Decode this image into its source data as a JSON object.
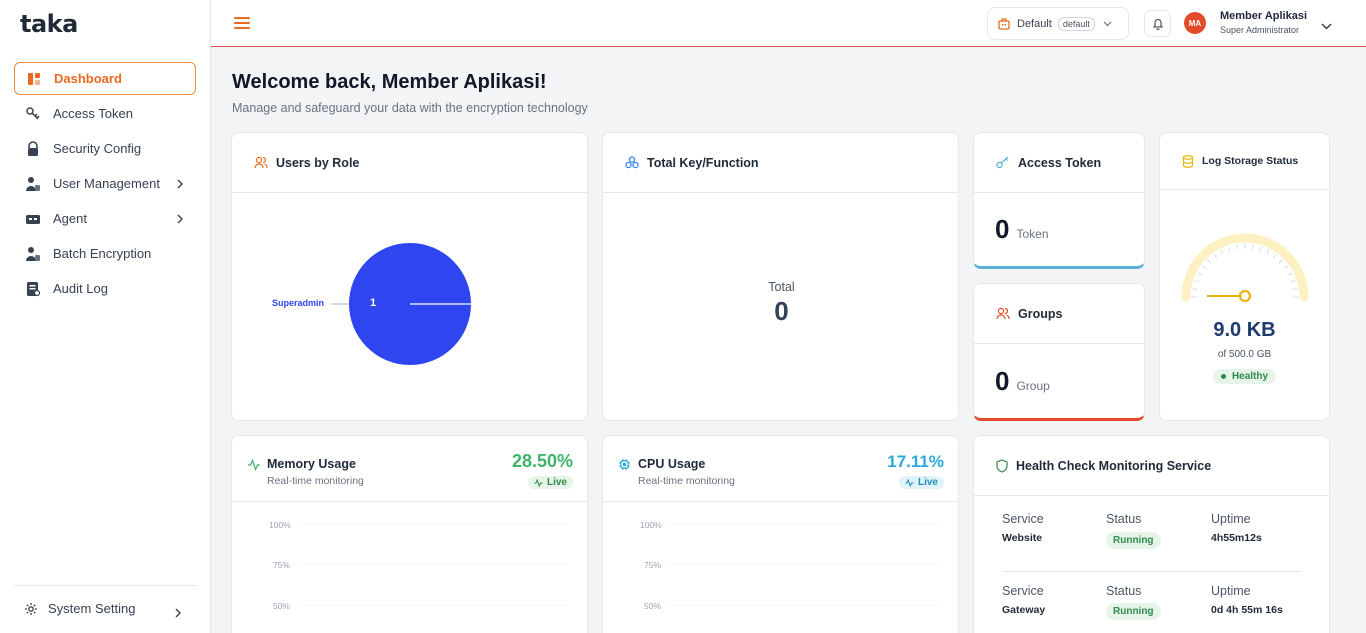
{
  "app": {
    "logo": "taka"
  },
  "sidebar": {
    "items": [
      {
        "label": "Dashboard"
      },
      {
        "label": "Access Token"
      },
      {
        "label": "Security Config"
      },
      {
        "label": "User Management"
      },
      {
        "label": "Agent"
      },
      {
        "label": "Batch Encryption"
      },
      {
        "label": "Audit Log"
      }
    ],
    "system_setting": "System Setting"
  },
  "header": {
    "tenant": "Default",
    "tenant_badge": "default",
    "user_initials": "MA",
    "user_name": "Member Aplikasi",
    "user_role": "Super Administrator"
  },
  "page": {
    "title": "Welcome back, Member Aplikasi!",
    "subtitle": "Manage and safeguard your data with the encryption technology"
  },
  "cards": {
    "users_by_role": {
      "title": "Users by Role",
      "legend_label": "Superadmin",
      "slice_value": "1",
      "chart_data": {
        "type": "pie",
        "categories": [
          "Superadmin"
        ],
        "values": [
          1
        ]
      }
    },
    "total_key": {
      "title": "Total Key/Function",
      "label": "Total",
      "value": "0"
    },
    "access_token": {
      "title": "Access Token",
      "value": "0",
      "unit": "Token"
    },
    "groups": {
      "title": "Groups",
      "value": "0",
      "unit": "Group"
    },
    "log_storage": {
      "title": "Log Storage Status",
      "used": "9.0 KB",
      "capacity": "of 500.0 GB",
      "status": "Healthy",
      "gauge_fraction": 0.0
    },
    "memory": {
      "title": "Memory Usage",
      "subtitle": "Real-time monitoring",
      "value": "28.50%",
      "live": "Live",
      "ticks": [
        "100%",
        "75%",
        "50%"
      ]
    },
    "cpu": {
      "title": "CPU Usage",
      "subtitle": "Real-time monitoring",
      "value": "17.11%",
      "live": "Live",
      "ticks": [
        "100%",
        "75%",
        "50%"
      ]
    },
    "health": {
      "title": "Health Check Monitoring Service",
      "col_service": "Service",
      "col_status": "Status",
      "col_uptime": "Uptime",
      "rows": [
        {
          "service": "Website",
          "status": "Running",
          "uptime": "4h55m12s"
        },
        {
          "service": "Gateway",
          "status": "Running",
          "uptime": "0d 4h 55m 16s"
        }
      ]
    }
  },
  "colors": {
    "accent": "#ea6a1f",
    "pie": "#2f45f0",
    "memory": "#3fb36b",
    "cpu": "#29a9d9",
    "token_bar": "#5aaed8",
    "group_bar": "#e24b2a",
    "gauge_track": "#fdf1c4",
    "gauge_mark": "#eab308"
  }
}
